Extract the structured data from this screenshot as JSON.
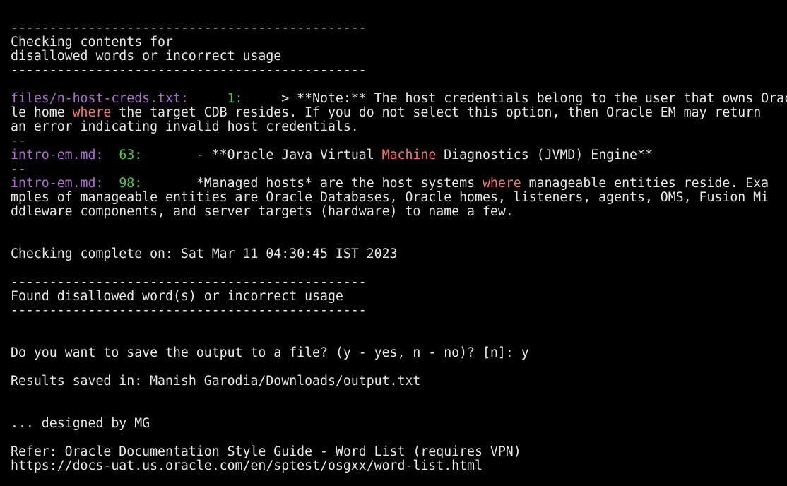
{
  "colors": {
    "background": "#000000",
    "text": "#e8e8e8",
    "filename": "#b36bd6",
    "line_number": "#4ec94e",
    "separator": "#3aa0c8",
    "highlight": "#ff6f6f"
  },
  "header": {
    "rule": "----------------------------------------------",
    "title_line1": "Checking contents for",
    "title_line2": "disallowed words or incorrect usage"
  },
  "matches": [
    {
      "file": "files/n-host-creds.txt:",
      "line": "1:",
      "gap": "     ",
      "pre": "> **Note:** The host credentials belong to the user that owns Orac",
      "line2_pre": "le home ",
      "keyword": "where",
      "line2_post": " the target CDB resides. If you do not select this option, then Oracle EM may return",
      "line3": "an error indicating invalid host credentials."
    },
    {
      "separator": "--",
      "file": "intro-em.md:",
      "line": "63:",
      "gap": "       ",
      "pre": "- **Oracle Java Virtual ",
      "keyword": "Machine",
      "post": " Diagnostics (JVMD) Engine**"
    },
    {
      "separator": "--",
      "file": "intro-em.md:",
      "line": "98:",
      "gap": "       ",
      "pre": "*Managed hosts* are the host systems ",
      "keyword": "where",
      "post": " manageable entities reside. Exa",
      "line2": "mples of manageable entities are Oracle Databases, Oracle homes, listeners, agents, OMS, Fusion Mi",
      "line3": "ddleware components, and server targets (hardware) to name a few."
    }
  ],
  "completion": "Checking complete on: Sat Mar 11 04:30:45 IST 2023",
  "result": {
    "rule": "----------------------------------------------",
    "message": "Found disallowed word(s) or incorrect usage"
  },
  "prompt": {
    "question": "Do you want to save the output to a file? (y - yes, n - no)? [n]: ",
    "answer": "y"
  },
  "saved": "Results saved in: Manish Garodia/Downloads/output.txt",
  "credit": "... designed by MG",
  "refer": {
    "line1": "Refer: Oracle Documentation Style Guide - Word List (requires VPN)",
    "line2": "https://docs-uat.us.oracle.com/en/sptest/osgxx/word-list.html"
  }
}
